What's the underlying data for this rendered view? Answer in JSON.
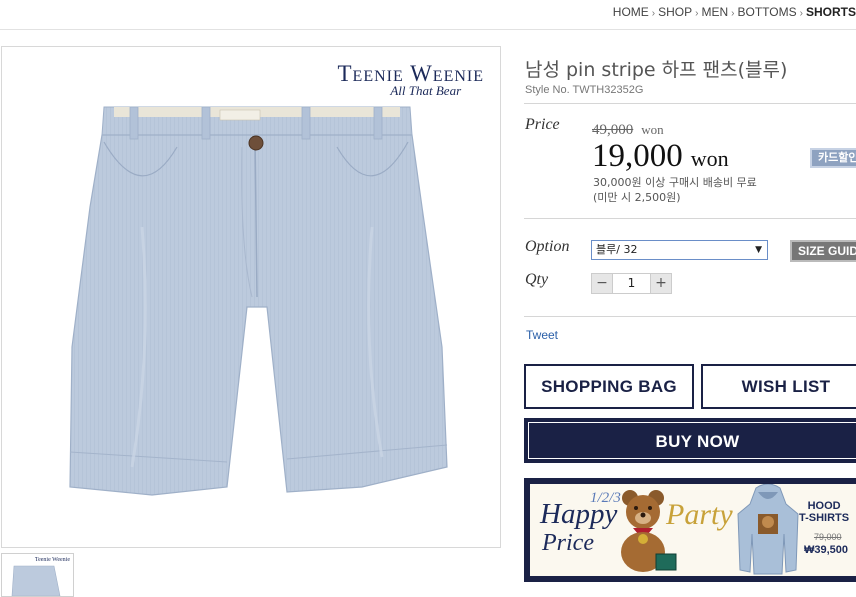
{
  "breadcrumb": {
    "items": [
      "HOME",
      "SHOP",
      "MEN",
      "BOTTOMS"
    ],
    "current": "SHORTS",
    "separator": "›"
  },
  "product": {
    "brand_name": "Teenie Weenie",
    "brand_tagline": "All That Bear",
    "title": "남성 pin stripe 하프 팬츠(블루)",
    "style_no": "Style No. TWTH32352G",
    "image_icon": "blue-shorts-photo"
  },
  "price": {
    "label": "Price",
    "original": "49,000",
    "original_unit": "won",
    "sale": "19,000",
    "sale_unit": "won",
    "shipping_line1": "30,000원 이상 구매시 배송비 무료",
    "shipping_line2": "(미만 시 2,500원)",
    "card_discount_button": "카드할인"
  },
  "option": {
    "label": "Option",
    "selected": "블루/ 32",
    "size_guide_button": "SIZE GUIDE"
  },
  "qty": {
    "label": "Qty",
    "value": "1",
    "minus": "−",
    "plus": "+"
  },
  "social": {
    "tweet": "Tweet"
  },
  "actions": {
    "shopping_bag": "SHOPPING BAG",
    "wish_list": "WISH LIST",
    "buy_now": "BUY NOW"
  },
  "banner": {
    "fraction": "1/2/3",
    "happy": "Happy",
    "price": "Price",
    "party": "Party",
    "hood_line1": "HOOD",
    "hood_line2": "T-SHIRTS",
    "old_price": "79,000",
    "new_price": "₩39,500"
  },
  "colors": {
    "navy": "#1a2145",
    "shorts": "#b9c8dc",
    "link": "#2a5fa8"
  }
}
